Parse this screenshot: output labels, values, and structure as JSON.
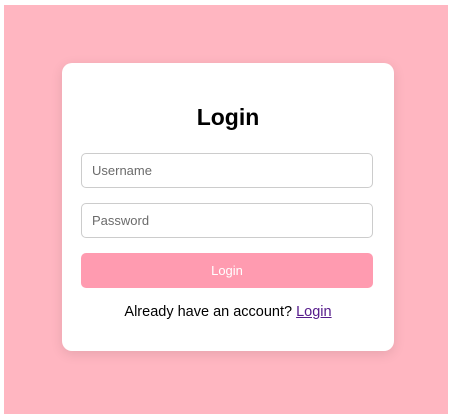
{
  "colors": {
    "background": "#ffb6c1",
    "card": "#ffffff",
    "button": "#ff9bb0",
    "link": "#551a8b"
  },
  "login_form": {
    "title": "Login",
    "username": {
      "value": "",
      "placeholder": "Username"
    },
    "password": {
      "value": "",
      "placeholder": "Password"
    },
    "submit_label": "Login",
    "footer_prompt": "Already have an account?",
    "footer_link_label": "Login"
  }
}
